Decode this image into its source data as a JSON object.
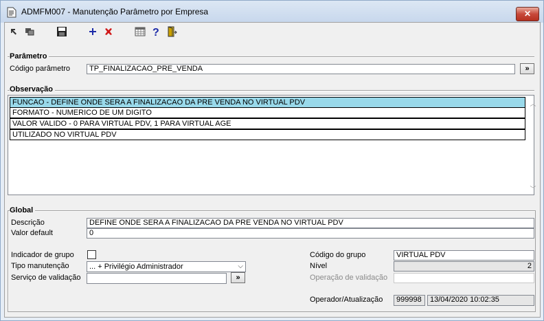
{
  "window": {
    "title": "ADMFM007 - Manutenção Parâmetro por Empresa",
    "close_label": "✕"
  },
  "toolbar": {
    "icons": [
      "navigate-icon",
      "multi-window-icon",
      "save-icon",
      "add-icon",
      "delete-icon",
      "calendar-grid-icon",
      "help-icon",
      "exit-door-icon"
    ]
  },
  "parametro": {
    "legend": "Parâmetro",
    "codigo_label": "Código parâmetro",
    "codigo_value": "TP_FINALIZACAO_PRE_VENDA",
    "lookup_label": "»"
  },
  "observacao": {
    "legend": "Observação",
    "lines": [
      "FUNCAO - DEFINE ONDE SERA A FINALIZACAO DA PRE VENDA NO VIRTUAL PDV",
      "FORMATO - NUMERICO DE UM DIGITO",
      "VALOR VALIDO - 0 PARA VIRTUAL PDV, 1 PARA VIRTUAL AGE",
      "UTILIZADO NO VIRTUAL PDV"
    ]
  },
  "global": {
    "legend": "Global",
    "descricao_label": "Descrição",
    "descricao_value": "DEFINE ONDE SERA A FINALIZACAO DA PRE VENDA NO VIRTUAL PDV",
    "valor_default_label": "Valor default",
    "valor_default_value": "0",
    "indicador_grupo_label": "Indicador de grupo",
    "indicador_grupo_checked": false,
    "tipo_manutencao_label": "Tipo manutenção",
    "tipo_manutencao_value": "... + Privilégio Administrador",
    "servico_validacao_label": "Serviço de validação",
    "servico_validacao_value": "",
    "servico_lookup_label": "»",
    "codigo_grupo_label": "Código do grupo",
    "codigo_grupo_value": "VIRTUAL PDV",
    "nivel_label": "Nível",
    "nivel_value": "2",
    "operacao_validacao_label": "Operação de validação",
    "operacao_validacao_value": "",
    "operador_label": "Operador/Atualização",
    "operador_value": "999998",
    "atualizacao_value": "13/04/2020 10:02:35"
  }
}
